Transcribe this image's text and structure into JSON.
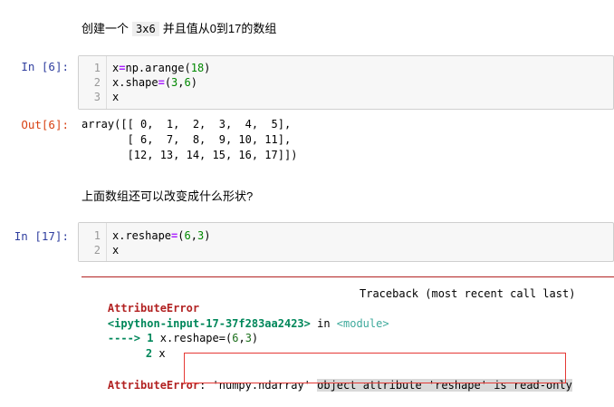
{
  "markdown1": {
    "before": "创建一个",
    "code": "3x6",
    "after": "并且值从0到17的数组"
  },
  "cell1": {
    "prompt": "In  [6]:",
    "lines": [
      {
        "n": "1",
        "code": "x=np.arange(18)"
      },
      {
        "n": "2",
        "code": "x.shape=(3,6)"
      },
      {
        "n": "3",
        "code": "x"
      }
    ],
    "out_prompt": "Out[6]:",
    "output": [
      "array([[ 0,  1,  2,  3,  4,  5],",
      "       [ 6,  7,  8,  9, 10, 11],",
      "       [12, 13, 14, 15, 16, 17]])"
    ]
  },
  "markdown2": {
    "text": "上面数组还可以改变成什么形状?"
  },
  "cell2": {
    "prompt": "In  [17]:",
    "lines": [
      {
        "n": "1",
        "code": "x.reshape=(6,3)"
      },
      {
        "n": "2",
        "code": "x"
      }
    ],
    "error": {
      "name": "AttributeError",
      "traceback_label": "Traceback (most recent call last)",
      "location": "<ipython-input-17-37f283aa2423>",
      "in_word": " in ",
      "module": "<module>",
      "arrow_line_prefix": "----> ",
      "arrow_line_num": "1",
      "arrow_line_code": "x.reshape=(6,3)",
      "next_line_num": "2",
      "next_line_code": "x",
      "message_name": "AttributeError",
      "message_colon": ":",
      "message_quoted": " 'numpy.ndarray'",
      "message_rest": "object attribute 'reshape' is read-only"
    }
  },
  "colors": {
    "in_prompt": "#303f9f",
    "out_prompt": "#d84315",
    "error_red": "#b22222",
    "highlight_box": "#e53935"
  }
}
